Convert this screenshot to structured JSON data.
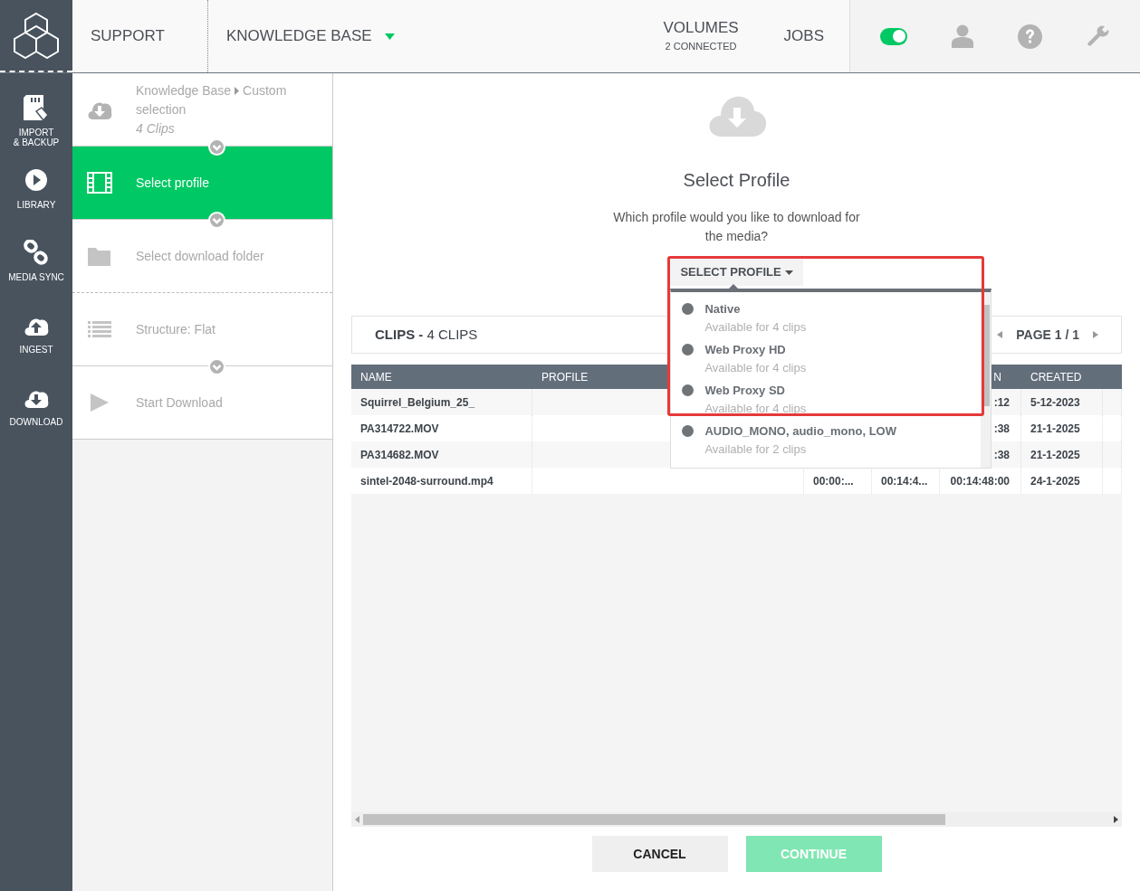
{
  "nav": {
    "links": [
      {
        "label": "SUPPORT",
        "dropdown": false
      },
      {
        "label": "KNOWLEDGE BASE",
        "dropdown": true
      }
    ],
    "volumes": {
      "label": "VOLUMES",
      "sub": "2 CONNECTED"
    },
    "jobs": "JOBS",
    "toggle": {
      "on": true
    }
  },
  "sidebar": {
    "items": [
      {
        "label": "IMPORT\n& BACKUP"
      },
      {
        "label": "LIBRARY"
      },
      {
        "label": "MEDIA SYNC"
      },
      {
        "label": "INGEST"
      },
      {
        "label": "DOWNLOAD"
      }
    ]
  },
  "steps": [
    {
      "kind": "breadcrumb",
      "path": [
        "Knowledge Base",
        "Custom selection"
      ],
      "note": "4 Clips",
      "selected": false
    },
    {
      "kind": "plain",
      "label": "Select profile",
      "selected": true
    },
    {
      "kind": "plain",
      "label": "Select download folder",
      "selected": false
    },
    {
      "kind": "plain",
      "label": "Structure: Flat",
      "selected": false
    },
    {
      "kind": "plain",
      "label": "Start Download",
      "selected": false
    }
  ],
  "dialog": {
    "title": "Select Profile",
    "question": "Which profile would you like to download for the media?",
    "select_button": "SELECT PROFILE",
    "profiles": [
      {
        "name": "Native",
        "availability": "Available for 4 clips"
      },
      {
        "name": "Web Proxy HD",
        "availability": "Available for 4 clips"
      },
      {
        "name": "Web Proxy SD",
        "availability": "Available for 4 clips"
      },
      {
        "name": "AUDIO_MONO, audio_mono, LOW",
        "availability": "Available for 2 clips"
      }
    ]
  },
  "clips": {
    "title": "**CLIPS -** 4 CLIPS",
    "page": "PAGE 1 / 1"
  },
  "table": {
    "columns": [
      "NAME",
      "PROFILE",
      null,
      null,
      "N",
      "CREATED",
      null
    ],
    "rows": [
      [
        "Squirrel_Belgium_25_",
        null,
        null,
        null,
        ":12",
        "5-12-2023",
        null
      ],
      [
        "PA314722.MOV",
        null,
        null,
        null,
        ":38",
        "21-1-2025",
        null
      ],
      [
        "PA314682.MOV",
        null,
        null,
        null,
        ":38",
        "21-1-2025",
        null
      ],
      [
        "sintel-2048-surround.mp4",
        null,
        "00:00:...",
        "00:14:4...",
        "00:14:48:00",
        "24-1-2025",
        null
      ]
    ]
  },
  "buttons": [
    {
      "label": "CANCEL",
      "kind": "secondary",
      "disabled": false
    },
    {
      "label": "CONTINUE",
      "kind": "primary",
      "disabled": true
    }
  ]
}
